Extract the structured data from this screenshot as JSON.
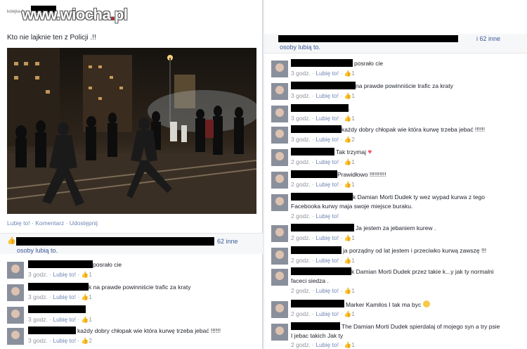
{
  "watermark": {
    "prefix": "www.",
    "dot": ".",
    "site": "wiocha",
    "tld": "pl"
  },
  "brand_small": "kolejka-1.",
  "post": {
    "caption": "Kto nie lajknie ten z Policji .!!",
    "actions": [
      "Lubię to!",
      "Komentarz",
      "Udostępnij"
    ],
    "separator": " · "
  },
  "likes": {
    "thumb": "👍",
    "others": "62 inne",
    "people": "osoby lubią to."
  },
  "left_comments": [
    {
      "text": "posrało cie",
      "time": "3 godz.",
      "like": "Lubię to!",
      "count": "1"
    },
    {
      "text": "k na prawde powinniście trafic za kraty",
      "time": "3 godz.",
      "like": "Lubię to!",
      "count": "1"
    },
    {
      "text": "",
      "time": "3 godz.",
      "like": "Lubię to!",
      "count": "1"
    },
    {
      "text": "każdy dobry chłopak wie która kurwę trzeba jebać !!!!!!",
      "time": "3 godz.",
      "like": "Lubię to!",
      "count": "2"
    }
  ],
  "right_likes": {
    "others": "i 62 inne",
    "people": "osoby lubią to."
  },
  "right_comments": [
    {
      "text": "posrało cie",
      "time": "3 godz.",
      "like": "Lubię to!",
      "count": "1"
    },
    {
      "text": "na prawde powinniście trafic za kraty",
      "time": "3 godz.",
      "like": "Lubię to!",
      "count": "1"
    },
    {
      "text": ".",
      "time": "3 godz.",
      "like": "Lubię to!",
      "count": "1"
    },
    {
      "text": "każdy dobry chłopak wie która kurwę trzeba jebać !!!!!!",
      "time": "3 godz.",
      "like": "Lubię to!",
      "count": "2"
    },
    {
      "text": "Tak trzymaj",
      "time": "2 godz.",
      "like": "Lubię to!",
      "count": "1",
      "extra": "heart"
    },
    {
      "text": "Prawidłowo !!!!!!!!!!",
      "time": "2 godz.",
      "like": "Lubię to!",
      "count": "1"
    },
    {
      "text": "k Damian Morti Dudek ty wez wypad kurwa z tego",
      "text2": "Facebooka kurwy maja swoje miejsce buraku.",
      "time": "2 godz.",
      "like": "Lubię to!",
      "count": ""
    },
    {
      "text": "Ja jestem za jebaniem kurew .",
      "time": "2 godz.",
      "like": "Lubię to!",
      "count": "1"
    },
    {
      "text": "ja porządny od lat jestem i przeciwko kurwą zawszę !!!",
      "time": "2 godz.",
      "like": "Lubię to!",
      "count": "1"
    },
    {
      "text": "k Damian Morti Dudek przez takie k...y jak ty normalni",
      "text2": "faceci siedza .",
      "time": "2 godz.",
      "like": "Lubię to!",
      "count": "1"
    },
    {
      "text": "Marker Kamilos I tak ma byc",
      "time": "2 godz.",
      "like": "Lubię to!",
      "count": "1",
      "extra": "smile"
    },
    {
      "text": "The Damian Morti Dudek spierdalaj of mojego syn a try psie",
      "text2": "I jebac takich Jak ty",
      "time": "2 godz.",
      "like": "Lubię to!",
      "count": "1"
    }
  ],
  "colors": {
    "link": "#3b5998",
    "meta": "#90949c",
    "watermark_red": "#e01b1b"
  },
  "icons": {
    "like": "thumbs-up-icon",
    "heart": "heart-icon",
    "smile": "smile-emoji-icon"
  }
}
